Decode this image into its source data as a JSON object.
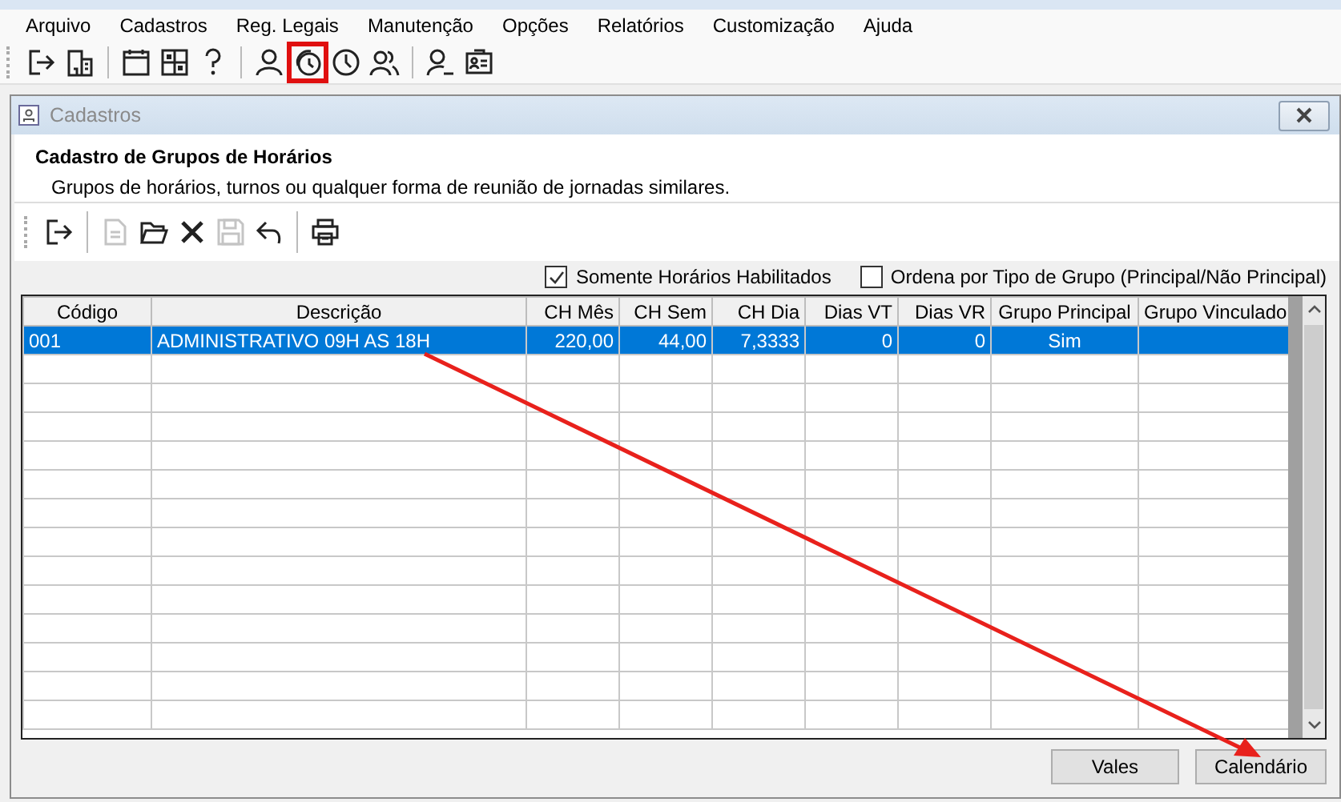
{
  "menu": [
    "Arquivo",
    "Cadastros",
    "Reg. Legais",
    "Manutenção",
    "Opções",
    "Relatórios",
    "Customização",
    "Ajuda"
  ],
  "toolbar": [
    {
      "kind": "exit",
      "highlighted": false
    },
    {
      "kind": "building",
      "highlighted": false
    },
    {
      "kind": "sep"
    },
    {
      "kind": "calendar",
      "highlighted": false
    },
    {
      "kind": "grid",
      "highlighted": false
    },
    {
      "kind": "question",
      "highlighted": false
    },
    {
      "kind": "sep"
    },
    {
      "kind": "person",
      "highlighted": false
    },
    {
      "kind": "clocks",
      "highlighted": true
    },
    {
      "kind": "clock",
      "highlighted": false
    },
    {
      "kind": "people",
      "highlighted": false
    },
    {
      "kind": "sep"
    },
    {
      "kind": "person-minus",
      "highlighted": false
    },
    {
      "kind": "id-card",
      "highlighted": false
    }
  ],
  "window": {
    "title": "Cadastros"
  },
  "header": {
    "title": "Cadastro de Grupos de Horários",
    "subtitle": "Grupos de horários, turnos ou qualquer forma de reunião de jornadas similares."
  },
  "form_toolbar": [
    {
      "kind": "exit",
      "disabled": false
    },
    {
      "kind": "sep"
    },
    {
      "kind": "document",
      "disabled": true
    },
    {
      "kind": "folder",
      "disabled": false
    },
    {
      "kind": "delete",
      "disabled": false
    },
    {
      "kind": "save",
      "disabled": true
    },
    {
      "kind": "undo",
      "disabled": false
    },
    {
      "kind": "sep"
    },
    {
      "kind": "printer",
      "disabled": false
    }
  ],
  "filters": [
    {
      "label": "Somente Horários Habilitados",
      "checked": true
    },
    {
      "label": "Ordena por Tipo de Grupo (Principal/Não Principal)",
      "checked": false
    }
  ],
  "table": {
    "columns": [
      "Código",
      "Descrição",
      "CH Mês",
      "CH Sem",
      "CH Dia",
      "Dias VT",
      "Dias VR",
      "Grupo Principal",
      "Grupo Vinculado"
    ],
    "rows": [
      {
        "selected": true,
        "cells": [
          "001",
          "ADMINISTRATIVO 09H AS 18H",
          "220,00",
          "44,00",
          "7,3333",
          "0",
          "0",
          "Sim"
        ]
      }
    ]
  },
  "buttons": [
    "Vales",
    "Calendário"
  ],
  "annotation": {
    "kind": "arrow"
  }
}
